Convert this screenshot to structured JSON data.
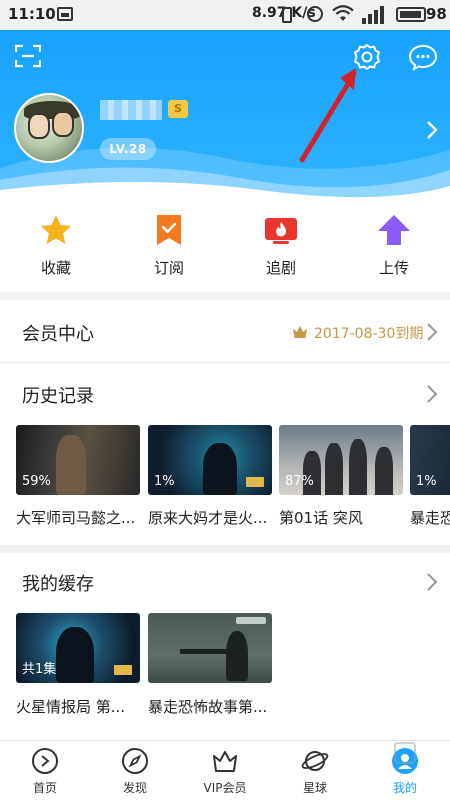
{
  "status_bar": {
    "time": "11:10",
    "net_speed": "8.97 K/s",
    "battery_level": "98"
  },
  "profile": {
    "level": "LV.28",
    "vip_badge": "S"
  },
  "quick_actions": [
    {
      "label": "收藏",
      "icon": "star-icon"
    },
    {
      "label": "订阅",
      "icon": "bookmark-check-icon"
    },
    {
      "label": "追剧",
      "icon": "tv-fire-icon"
    },
    {
      "label": "上传",
      "icon": "upload-arrow-icon"
    }
  ],
  "membership": {
    "title": "会员中心",
    "expire": "2017-08-30到期"
  },
  "history": {
    "title": "历史记录",
    "items": [
      {
        "progress": "59%",
        "caption": "大军师司马懿之..."
      },
      {
        "progress": "1%",
        "caption": "原来大妈才是火..."
      },
      {
        "progress": "87%",
        "caption": "第01话 突风"
      },
      {
        "progress": "1%",
        "caption": "暴走恐"
      }
    ]
  },
  "cache": {
    "title": "我的缓存",
    "items": [
      {
        "badge": "共1集",
        "caption": "火星情报局 第..."
      },
      {
        "badge": "",
        "caption": "暴走恐怖故事第..."
      }
    ]
  },
  "bottom_nav": [
    {
      "label": "首页",
      "icon": "play-circle-icon"
    },
    {
      "label": "发现",
      "icon": "compass-icon"
    },
    {
      "label": "VIP会员",
      "icon": "crown-icon"
    },
    {
      "label": "星球",
      "icon": "planet-icon"
    },
    {
      "label": "我的",
      "icon": "person-icon",
      "active": true
    }
  ],
  "colors": {
    "header_blue": "#16a3ff",
    "accent_gold": "#c39a46",
    "arrow_red": "#d3222b",
    "active_tab": "#1aa3ff"
  }
}
